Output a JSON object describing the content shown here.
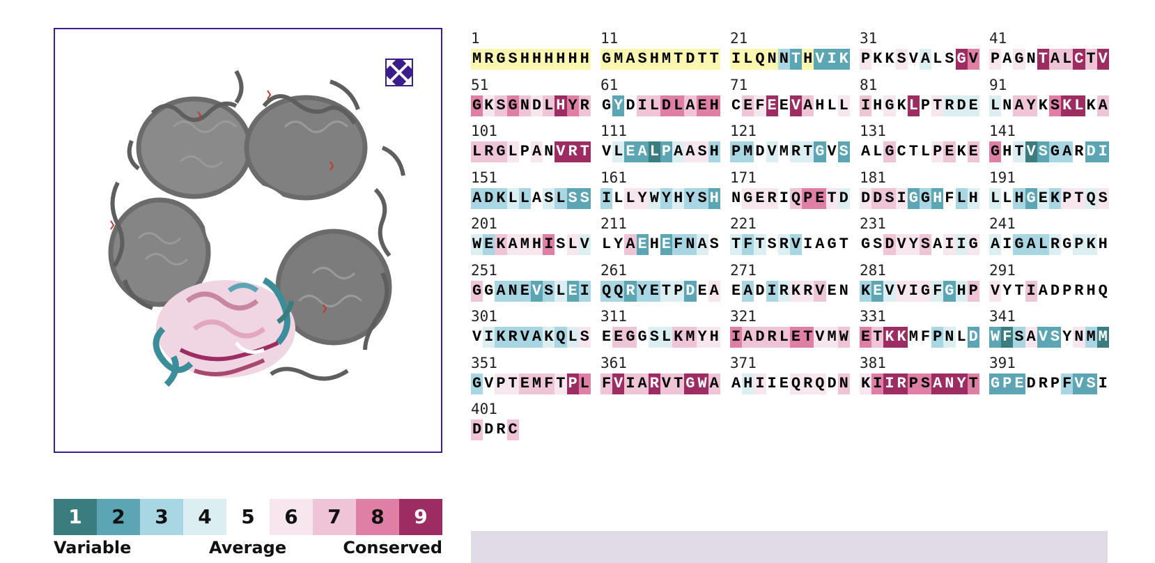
{
  "sequence": {
    "block_size": 10,
    "residues": "MRGSHHHHHHGMASHMTDTTILQNNTHVIKPKKSVALSGVPAGNTALCTVGKSGNDLHYRGYDILDLAEHCEFEEVAHLLIHGKLPTRDELNAYKSKLKALRGLPANVRTVLEALPAASHPMDVMRTGVSALGCTLPEKEGHTVSGARDIADKLLASLSSILLYWYHYSHNGERIQPETDDDSIGGHFLHLLHGEKPTQSWEKAMHISLVLYAEHEFNASTFTSRVIAGTGSDVYSAIIGAIGALRGPKHGGANEVSLEIQQRYETPDEAEADIRKRVENKEVVIGFGHPVYTIADPRHQVIKRVAKQLSEEGGSLKMYHIADRLETVMWETKKMFPNLDWFSAVSYNMMGVPTEMFTPLFVIARVTGWAAHIIEQRQDNKIIRPSANYTGPEDRPFVSIDDRC",
    "grades": "YYYYYYYYYYYYYYYYYYYYYYYY32Y2226556545598656597797986787679875257788788576959755675659564444577589957777656599954221246633354544252557555675785412335223334354322356643433256665788646776232534453243664643766685645572523345434543555555766756464533345445753332342333233442565353466755324666424765575555555433334346577544776687777886678799553452213622563135667776987977977997546556665768998899982225553225755755656999577422212232532455545655542324422136665585786456865443343443222223577865549988556553355555445557757797798975696955545564899857656778799755212422434213328YY",
    "grade_colors": {
      "1": {
        "bg": "#3b7d7e",
        "fg": "#ffffff"
      },
      "2": {
        "bg": "#5ba5b5",
        "fg": "#ffffff"
      },
      "3": {
        "bg": "#a8d6e2",
        "fg": "#000000"
      },
      "4": {
        "bg": "#dbeff2",
        "fg": "#000000"
      },
      "5": {
        "bg": "#ffffff",
        "fg": "#000000"
      },
      "6": {
        "bg": "#f7e6ee",
        "fg": "#000000"
      },
      "7": {
        "bg": "#f0c4d7",
        "fg": "#000000"
      },
      "8": {
        "bg": "#df7fa6",
        "fg": "#000000"
      },
      "9": {
        "bg": "#9c2c62",
        "fg": "#ffffff"
      },
      "Y": {
        "bg": "#fbf6b0",
        "fg": "#000000"
      }
    }
  },
  "viewer": {
    "expand_icon": "expand-arrows-icon",
    "expand_icon_color": "#3a1c8c",
    "border_color": "#3a1c8c"
  },
  "legend": {
    "scale": [
      {
        "label": "1",
        "bg": "#3b7d7e",
        "fg": "#ffffff"
      },
      {
        "label": "2",
        "bg": "#5ba5b5",
        "fg": "#111111"
      },
      {
        "label": "3",
        "bg": "#a8d6e2",
        "fg": "#111111"
      },
      {
        "label": "4",
        "bg": "#dbeff2",
        "fg": "#111111"
      },
      {
        "label": "5",
        "bg": "#ffffff",
        "fg": "#111111"
      },
      {
        "label": "6",
        "bg": "#f7e6ee",
        "fg": "#111111"
      },
      {
        "label": "7",
        "bg": "#f0c4d7",
        "fg": "#111111"
      },
      {
        "label": "8",
        "bg": "#df7fa6",
        "fg": "#111111"
      },
      {
        "label": "9",
        "bg": "#9c2c62",
        "fg": "#ffffff"
      }
    ],
    "variable_label": "Variable",
    "average_label": "Average",
    "conserved_label": "Conserved"
  }
}
